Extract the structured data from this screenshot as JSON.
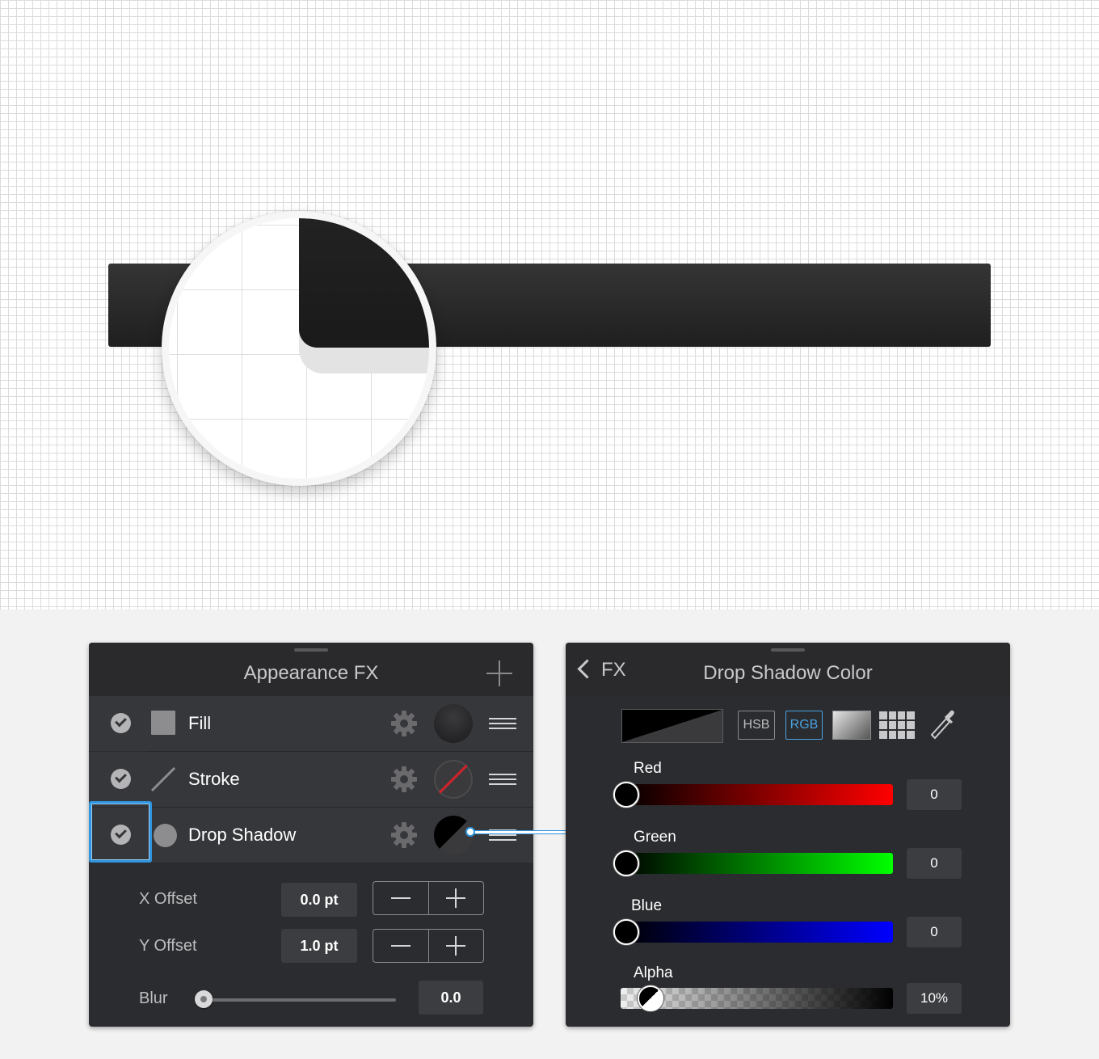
{
  "appearance_panel": {
    "title": "Appearance FX",
    "effects": [
      {
        "label": "Fill",
        "enabled": true
      },
      {
        "label": "Stroke",
        "enabled": true
      },
      {
        "label": "Drop Shadow",
        "enabled": true
      }
    ],
    "x_offset": {
      "label": "X Offset",
      "value": "0.0 pt"
    },
    "y_offset": {
      "label": "Y Offset",
      "value": "1.0 pt"
    },
    "blur": {
      "label": "Blur",
      "value": "0.0",
      "level": 0
    }
  },
  "color_panel": {
    "back_label": "FX",
    "title": "Drop Shadow Color",
    "modes": {
      "hsb": "HSB",
      "rgb": "RGB",
      "active": "RGB"
    },
    "sliders": [
      {
        "label": "Red",
        "value": "0",
        "fraction": 0
      },
      {
        "label": "Green",
        "value": "0",
        "fraction": 0
      },
      {
        "label": "Blue",
        "value": "0",
        "fraction": 0
      },
      {
        "label": "Alpha",
        "value": "10%",
        "fraction": 0.1
      }
    ],
    "colors": {
      "red": "#ff0000",
      "green": "#00ff00",
      "blue": "#0000ff",
      "highlight": "#2f95e0"
    }
  }
}
